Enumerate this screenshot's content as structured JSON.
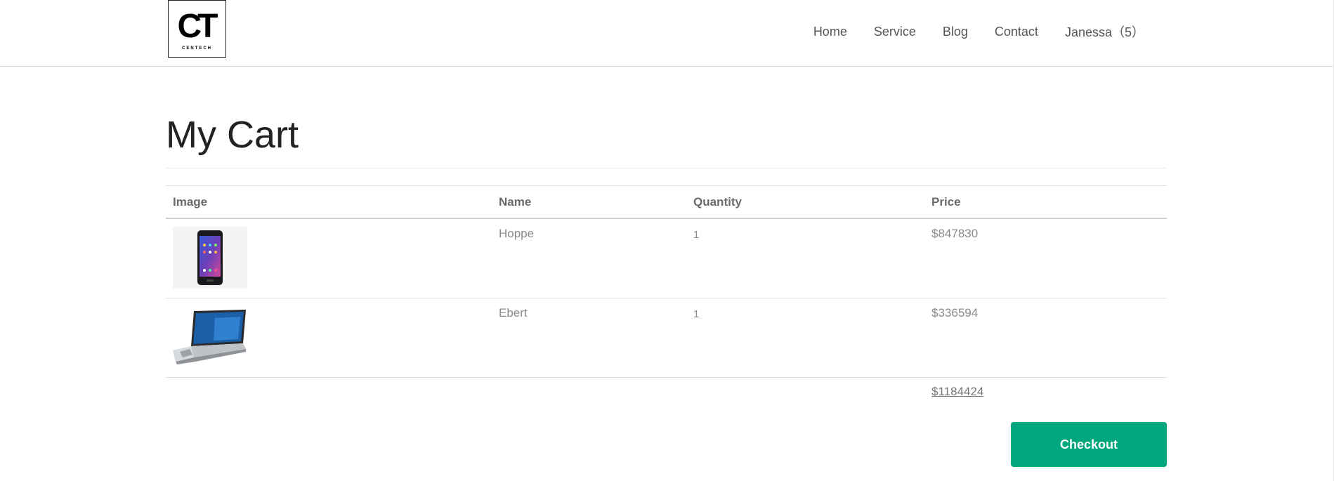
{
  "header": {
    "logo_mark": "CT",
    "logo_text": "CENTECH",
    "nav": [
      {
        "label": "Home"
      },
      {
        "label": "Service"
      },
      {
        "label": "Blog"
      },
      {
        "label": "Contact"
      },
      {
        "label": "Janessa（5）"
      }
    ]
  },
  "main": {
    "title": "My Cart",
    "table": {
      "columns": [
        "Image",
        "Name",
        "Quantity",
        "Price"
      ],
      "rows": [
        {
          "image_icon": "smartphone-icon",
          "name": "Hoppe",
          "quantity": "1",
          "price": "$847830"
        },
        {
          "image_icon": "laptop-icon",
          "name": "Ebert",
          "quantity": "1",
          "price": "$336594"
        }
      ],
      "total": "$1184424"
    },
    "checkout_label": "Checkout"
  },
  "colors": {
    "accent": "#00a67e",
    "text_muted": "#8a8a8a",
    "heading": "#222222"
  }
}
